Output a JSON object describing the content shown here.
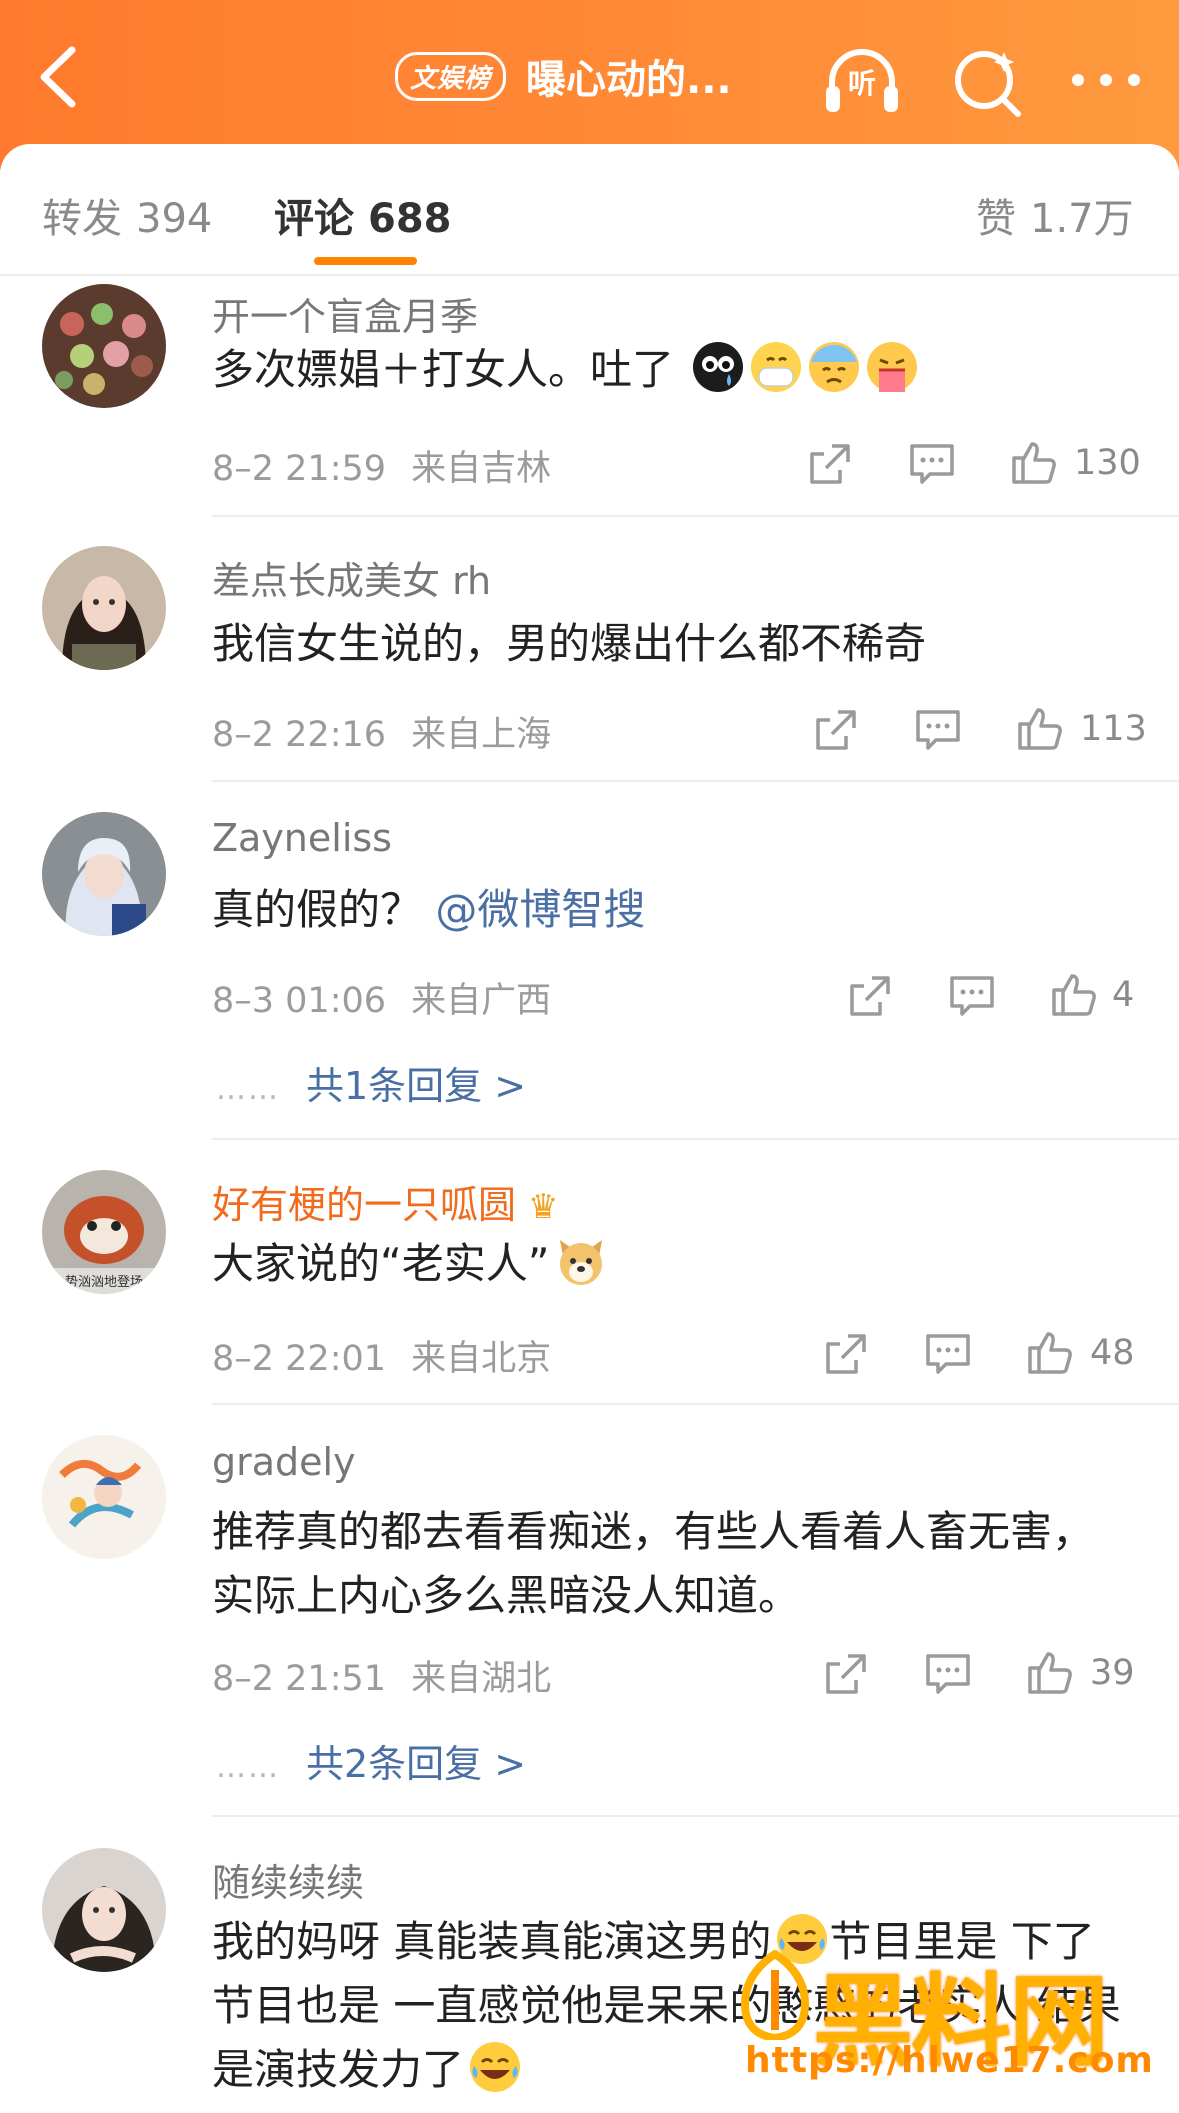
{
  "header": {
    "tag": "文娱榜",
    "title": "曝心动的...",
    "listen_label": "听",
    "icons": [
      "back-icon",
      "headphones-icon",
      "search-icon",
      "more-icon"
    ]
  },
  "tabs": [
    {
      "label": "转发",
      "count": "394"
    },
    {
      "label": "评论",
      "count": "688"
    },
    {
      "label": "赞",
      "count": "1.7万"
    }
  ],
  "comments": [
    {
      "username": "开一个盲盒月季",
      "text": "多次嫖娼＋打女人。吐了",
      "emojis": [
        "black-teary-face",
        "mask-face",
        "cold-sweat-face",
        "vomit-face"
      ],
      "time": "8–2 21:59",
      "location": "来自吉林",
      "likes": "130"
    },
    {
      "username": "差点长成美女 rh",
      "text": "我信女生说的，男的爆出什么都不稀奇",
      "time": "8–2 22:16",
      "location": "来自上海",
      "likes": "113"
    },
    {
      "username": "Zayneliss",
      "text": "真的假的？",
      "mention": "@微博智搜",
      "time": "8–3 01:06",
      "location": "来自广西",
      "likes": "4",
      "replies": "共1条回复 >"
    },
    {
      "username": "好有梗的一只呱圆",
      "text": "大家说的“老实人”",
      "emojis": [
        "dog-face"
      ],
      "time": "8–2 22:01",
      "location": "来自北京",
      "likes": "48"
    },
    {
      "username": "gradely",
      "text": "推荐真的都去看看痴迷，有些人看着人畜无害，实际上内心多么黑暗没人知道。",
      "time": "8–2 21:51",
      "location": "来自湖北",
      "likes": "39",
      "replies": "共2条回复 >"
    },
    {
      "username": "随续续续",
      "text": "我的妈呀 真能装真能演这男的",
      "text2": "节目里是 下了节目也是 一直感觉他是呆呆的憨憨的老实人 结果是演技发力了",
      "emojis": [
        "laughing-tears-face",
        "laughing-tears-face"
      ]
    }
  ],
  "avatar_label": "势汹汹地登场",
  "watermark": {
    "text": "黑料网",
    "url": "https://hlwe17.com"
  },
  "colors": {
    "header": "#ff8a36",
    "accent": "#ff8200",
    "link": "#4a6fa5",
    "vip_name": "#f26b1d"
  }
}
